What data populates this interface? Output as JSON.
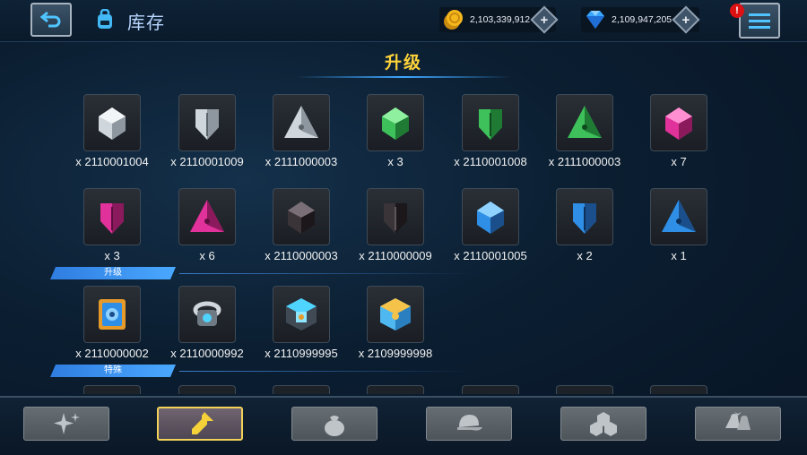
{
  "header": {
    "title": "库存",
    "gold_amount": "2,103,339,912",
    "gem_amount": "2,109,947,205",
    "plus_label": "+",
    "alert_badge": "!"
  },
  "section": {
    "title": "升级"
  },
  "categories": {
    "upgrade": "升级",
    "special": "特殊"
  },
  "items": {
    "row1": [
      "x 2110001004",
      "x 2110001009",
      "x 2111000003",
      "x 3",
      "x 2110001008",
      "x 2111000003",
      "x 7"
    ],
    "row2": [
      "x 3",
      "x 6",
      "x 2110000003",
      "x 2110000009",
      "x 2110001005",
      "x 2",
      "x 1"
    ],
    "row3": [
      "x 2110000002",
      "x 2110000992",
      "x 2110999995",
      "x 2109999998"
    ]
  },
  "colors": {
    "accent": "#ffd33a",
    "category": "#3a8ff0",
    "silver": "#cfd6dc",
    "green": "#3ec15a",
    "pink": "#e0329a",
    "black": "#3a3338",
    "blue": "#2f8fe6"
  },
  "tabs": [
    "sparkle-icon",
    "arrow-up-icon",
    "bag-icon",
    "cap-icon",
    "cubes-icon",
    "bells-icon"
  ]
}
